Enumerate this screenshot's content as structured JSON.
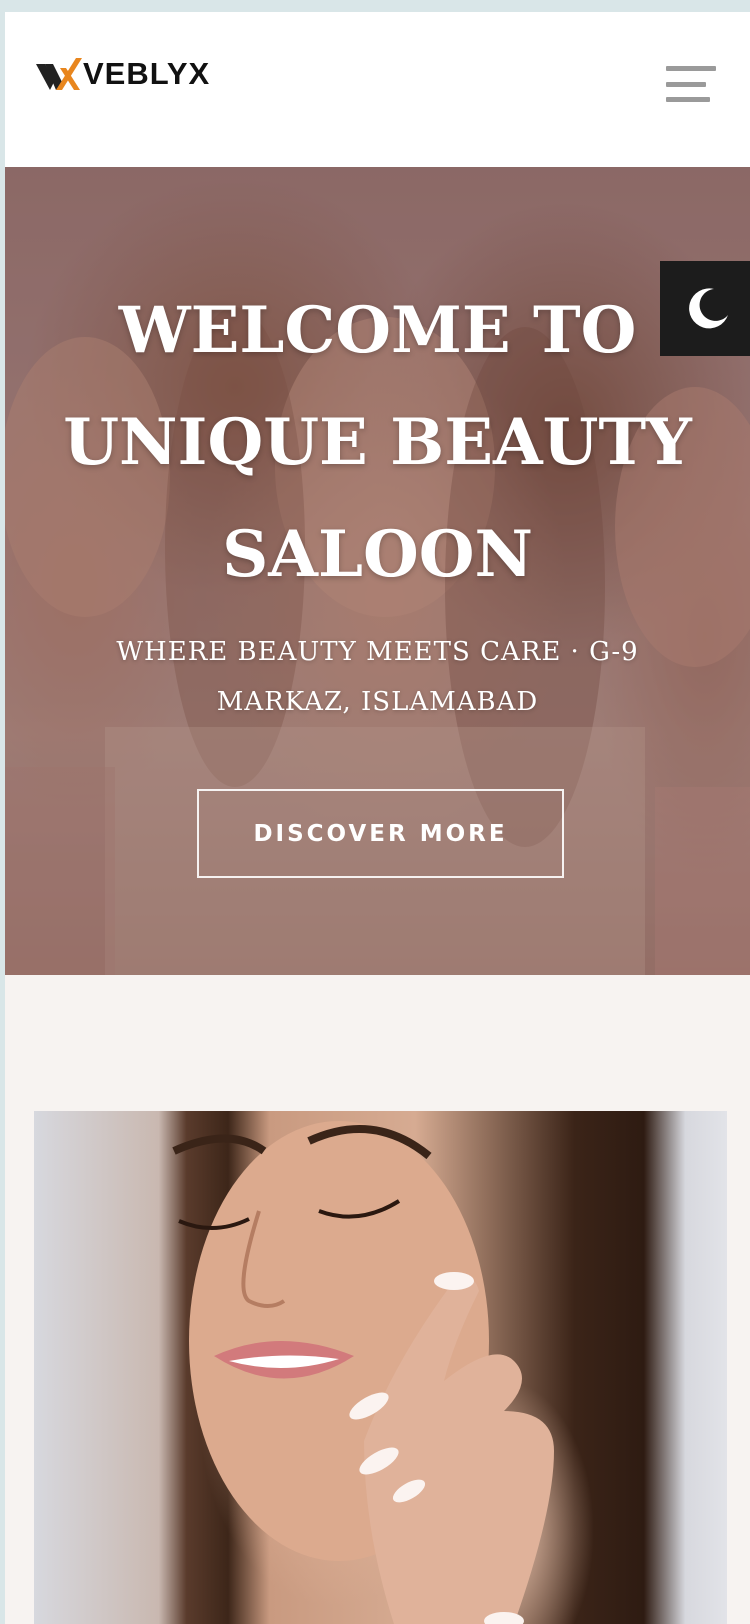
{
  "header": {
    "logo_text": "VEBLYX",
    "menu_icon": "hamburger-menu-icon"
  },
  "hero": {
    "title_line1": "WELCOME TO",
    "title_line2": "UNIQUE BEAUTY",
    "title_line3": "SALOON",
    "subtitle_line1": "WHERE BEAUTY MEETS CARE · G-9",
    "subtitle_line2": "MARKAZ, ISLAMABAD",
    "button_label": "DISCOVER MORE"
  },
  "theme_toggle": {
    "icon": "moon-icon"
  },
  "colors": {
    "logo_accent": "#e8861e",
    "logo_dark": "#222222",
    "toggle_bg": "#1c1c1c",
    "page_bg": "#f7f3f1"
  }
}
